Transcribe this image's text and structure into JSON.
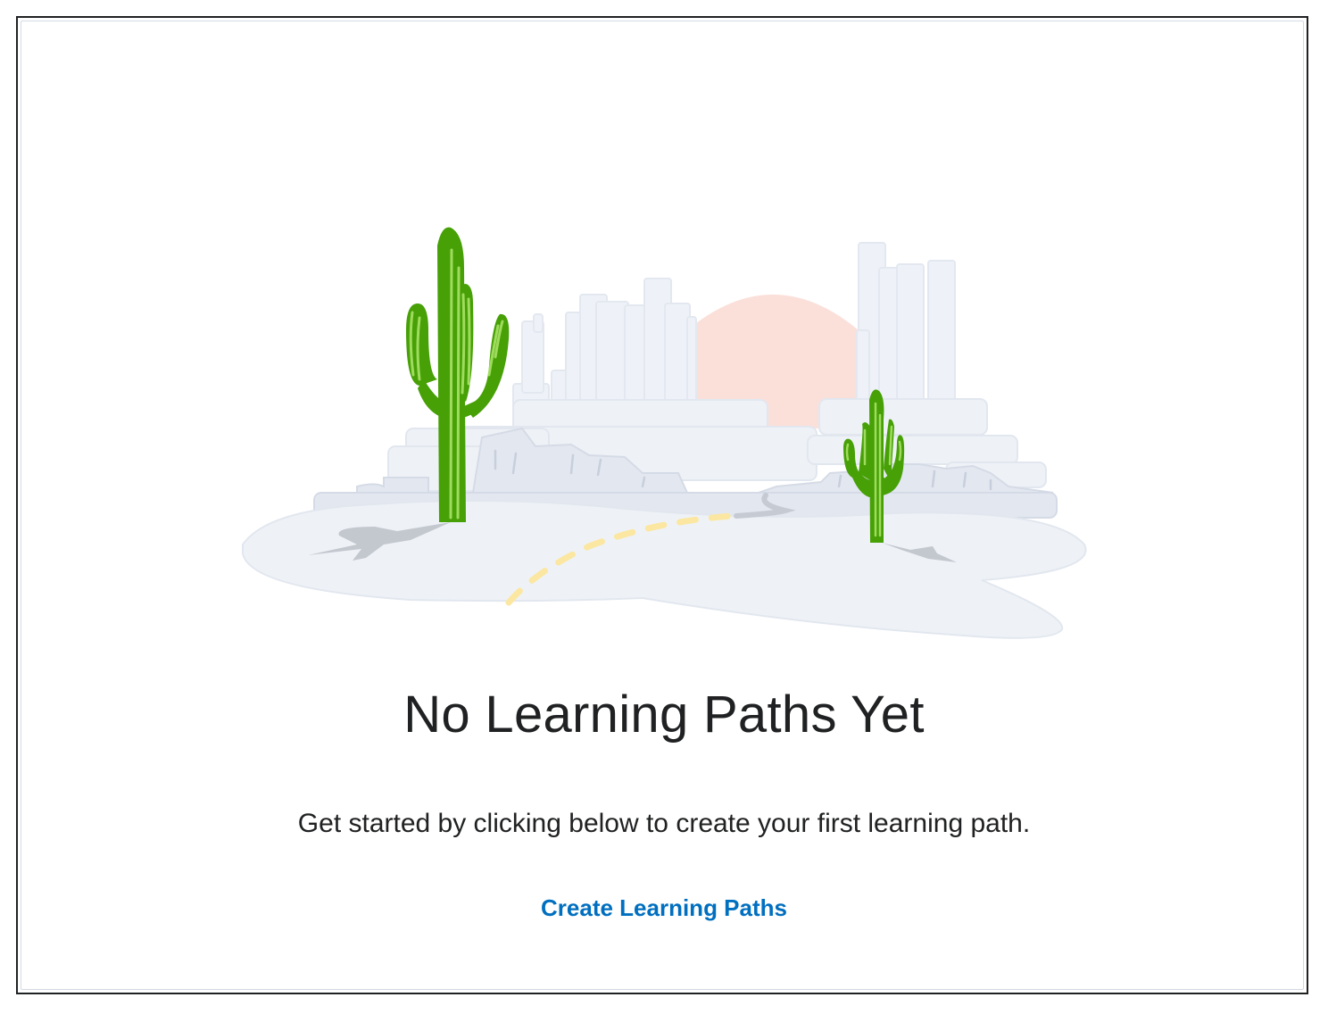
{
  "empty_state": {
    "title": "No Learning Paths Yet",
    "description": "Get started by clicking below to create your first learning path.",
    "action_label": "Create Learning Paths"
  },
  "illustration": {
    "name": "desert-cactus-illustration"
  },
  "colors": {
    "text": "#202122",
    "link": "#006fbf",
    "cactus_dark": "#46a006",
    "cactus_light": "#8ed14a",
    "sun": "#fbe0da",
    "skyline": "#edf1f7",
    "ground": "#eef2f7",
    "road_dash": "#fde68a"
  }
}
